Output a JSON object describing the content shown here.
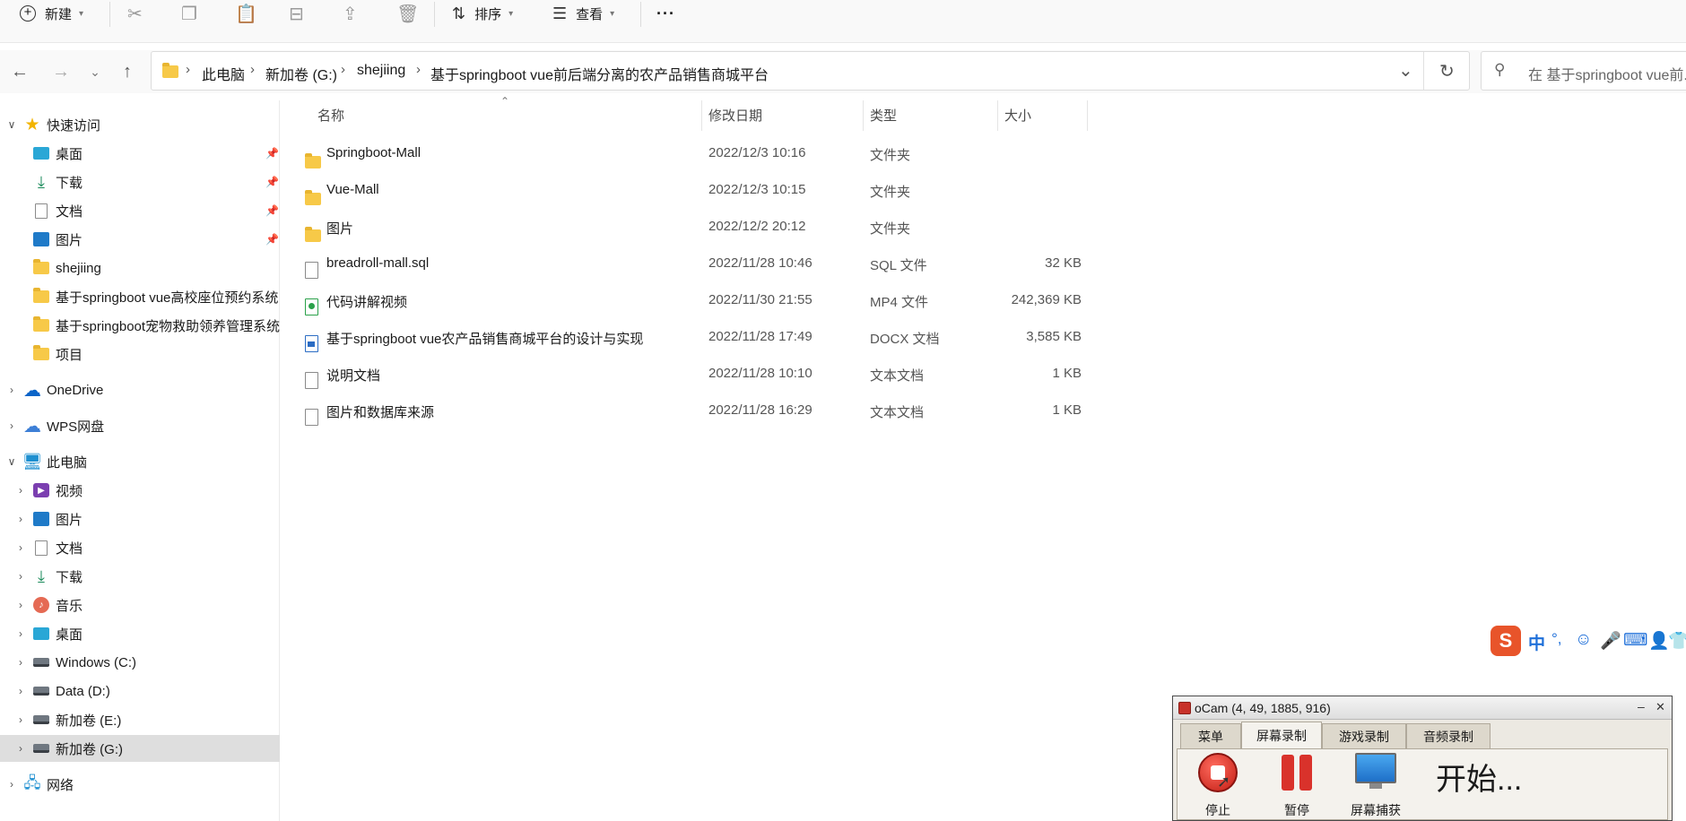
{
  "toolbar": {
    "new_label": "新建",
    "sort_label": "排序",
    "view_label": "查看",
    "more_glyph": "···"
  },
  "nav": {
    "back_glyph": "←",
    "forward_glyph": "→",
    "recent_glyph": "⌄",
    "up_glyph": "↑",
    "refresh_glyph": "↻",
    "dropdown_glyph": "⌄"
  },
  "address": {
    "crumbs": [
      "此电脑",
      "新加卷 (G:)",
      "shejiing",
      "基于springboot vue前后端分离的农产品销售商城平台"
    ],
    "separator": "›"
  },
  "search": {
    "placeholder": "在 基于springboot vue前..."
  },
  "sidebar": {
    "quick_access": "快速访问",
    "quick_items": [
      "桌面",
      "下载",
      "文档",
      "图片",
      "shejiing",
      "基于springboot vue高校座位预约系统",
      "基于springboot宠物救助领养管理系统",
      "项目"
    ],
    "onedrive": "OneDrive",
    "wps": "WPS网盘",
    "this_pc": "此电脑",
    "pc_items": [
      "视频",
      "图片",
      "文档",
      "下载",
      "音乐",
      "桌面",
      "Windows (C:)",
      "Data (D:)",
      "新加卷 (E:)",
      "新加卷 (G:)"
    ],
    "network": "网络"
  },
  "columns": {
    "name": "名称",
    "date": "修改日期",
    "type": "类型",
    "size": "大小"
  },
  "files": [
    {
      "name": "Springboot-Mall",
      "date": "2022/12/3 10:16",
      "type": "文件夹",
      "size": "",
      "icon": "folder-icon"
    },
    {
      "name": "Vue-Mall",
      "date": "2022/12/3 10:15",
      "type": "文件夹",
      "size": "",
      "icon": "folder-icon"
    },
    {
      "name": "图片",
      "date": "2022/12/2 20:12",
      "type": "文件夹",
      "size": "",
      "icon": "folder-icon"
    },
    {
      "name": "breadroll-mall.sql",
      "date": "2022/11/28 10:46",
      "type": "SQL 文件",
      "size": "32 KB",
      "icon": "sql-file-icon"
    },
    {
      "name": "代码讲解视频",
      "date": "2022/11/30 21:55",
      "type": "MP4 文件",
      "size": "242,369 KB",
      "icon": "video-file-icon"
    },
    {
      "name": "基于springboot vue农产品销售商城平台的设计与实现",
      "date": "2022/11/28 17:49",
      "type": "DOCX 文档",
      "size": "3,585 KB",
      "icon": "docx-file-icon"
    },
    {
      "name": "说明文档",
      "date": "2022/11/28 10:10",
      "type": "文本文档",
      "size": "1 KB",
      "icon": "text-file-icon"
    },
    {
      "name": "图片和数据库来源",
      "date": "2022/11/28 16:29",
      "type": "文本文档",
      "size": "1 KB",
      "icon": "text-file-icon"
    }
  ],
  "ime": {
    "mode": "中",
    "punct": "°,"
  },
  "ocam": {
    "title": "oCam (4, 49, 1885, 916)",
    "min_glyph": "–",
    "close_glyph": "✕",
    "tabs": [
      "菜单",
      "屏幕录制",
      "游戏录制",
      "音频录制"
    ],
    "stop_label": "停止",
    "pause_label": "暂停",
    "capture_label": "屏幕捕获",
    "status": "开始..."
  },
  "colors": {
    "accent": "#0067c0",
    "selected_row": "#dedede",
    "folder": "#f7c948",
    "record_red": "#d9322b"
  }
}
